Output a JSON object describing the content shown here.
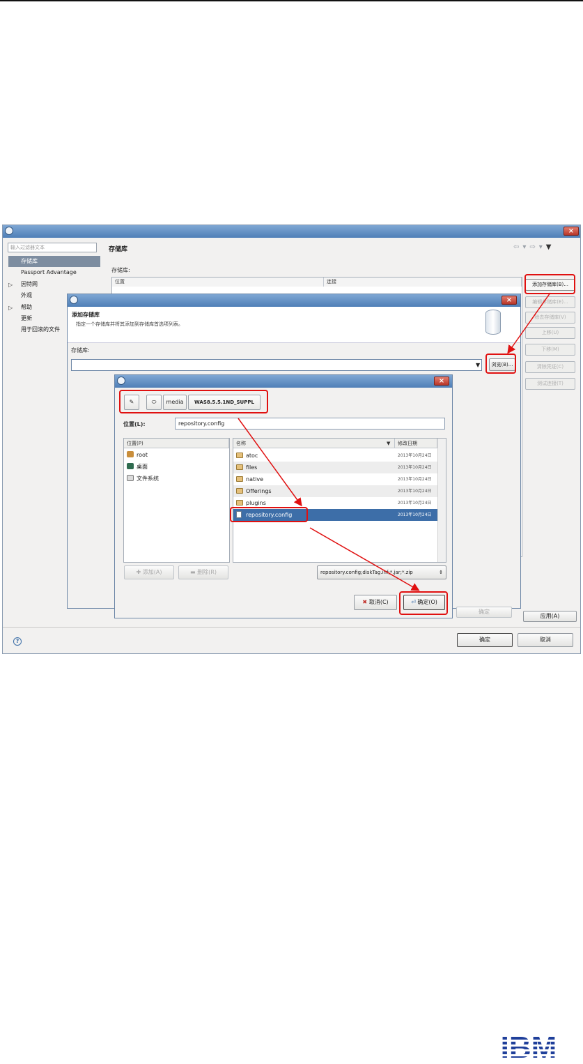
{
  "window": {
    "filter_placeholder": "输入过滤器文本",
    "nav": [
      {
        "label": "存储库",
        "selected": true,
        "expandable": false
      },
      {
        "label": "Passport Advantage",
        "selected": false,
        "expandable": false
      },
      {
        "label": "因特网",
        "selected": false,
        "expandable": true
      },
      {
        "label": "外观",
        "selected": false,
        "expandable": false
      },
      {
        "label": "帮助",
        "selected": false,
        "expandable": true
      },
      {
        "label": "更新",
        "selected": false,
        "expandable": false
      },
      {
        "label": "用于回滚的文件",
        "selected": false,
        "expandable": false
      }
    ],
    "page_title": "存储库",
    "section_label": "存储库:",
    "table_headers": [
      "位置",
      "连接"
    ],
    "side_buttons": [
      {
        "label": "添加存储库(B)...",
        "enabled": true
      },
      {
        "label": "编辑存储库(E)...",
        "enabled": false
      },
      {
        "label": "除去存储库(V)",
        "enabled": false
      },
      {
        "label": "上移(U)",
        "enabled": false
      },
      {
        "label": "下移(M)",
        "enabled": false
      },
      {
        "label": "清除凭证(C)",
        "enabled": false
      },
      {
        "label": "测试连接(T)",
        "enabled": false
      }
    ],
    "apply_label": "应用(A)",
    "ok_label": "确定",
    "cancel_label": "取消",
    "help_icon": "question-icon"
  },
  "add_dialog": {
    "title": "添加存储库",
    "description": "指定一个存储库并将其添加到存储库首选项列表。",
    "repo_label": "存储库:",
    "repo_value": "",
    "browse_label": "浏览(B)...",
    "ok_label": "确定"
  },
  "file_dialog": {
    "breadcrumbs": [
      "media",
      "WAS8.5.5.1ND_SUPPL"
    ],
    "location_label": "位置(L):",
    "location_value": "repository.config",
    "places_header": "位置(P)",
    "places": [
      {
        "label": "root",
        "icon": "home-folder-icon"
      },
      {
        "label": "桌面",
        "icon": "desktop-icon"
      },
      {
        "label": "文件系统",
        "icon": "drive-icon"
      }
    ],
    "col_name": "名称",
    "col_modified": "修改日期",
    "files": [
      {
        "name": "atoc",
        "modified": "2013年10月24日",
        "type": "folder",
        "selected": false
      },
      {
        "name": "files",
        "modified": "2013年10月24日",
        "type": "folder",
        "selected": false
      },
      {
        "name": "native",
        "modified": "2013年10月24日",
        "type": "folder",
        "selected": false
      },
      {
        "name": "Offerings",
        "modified": "2013年10月24日",
        "type": "folder",
        "selected": false
      },
      {
        "name": "plugins",
        "modified": "2013年10月24日",
        "type": "folder",
        "selected": false
      },
      {
        "name": "repository.config",
        "modified": "2013年10月24日",
        "type": "file",
        "selected": true
      }
    ],
    "add_label": "添加(A)",
    "remove_label": "删除(R)",
    "filter_value": "repository.config;diskTag.inf;*.jar;*.zip",
    "cancel_label": "取消(C)",
    "open_label": "确定(O)"
  },
  "footer": {
    "logo_text": "IBM"
  },
  "colors": {
    "annotation": "#e01010",
    "selection": "#3d6ea8",
    "titlebar": "#4f7fb7",
    "ibm_blue": "#1f3f9a"
  }
}
